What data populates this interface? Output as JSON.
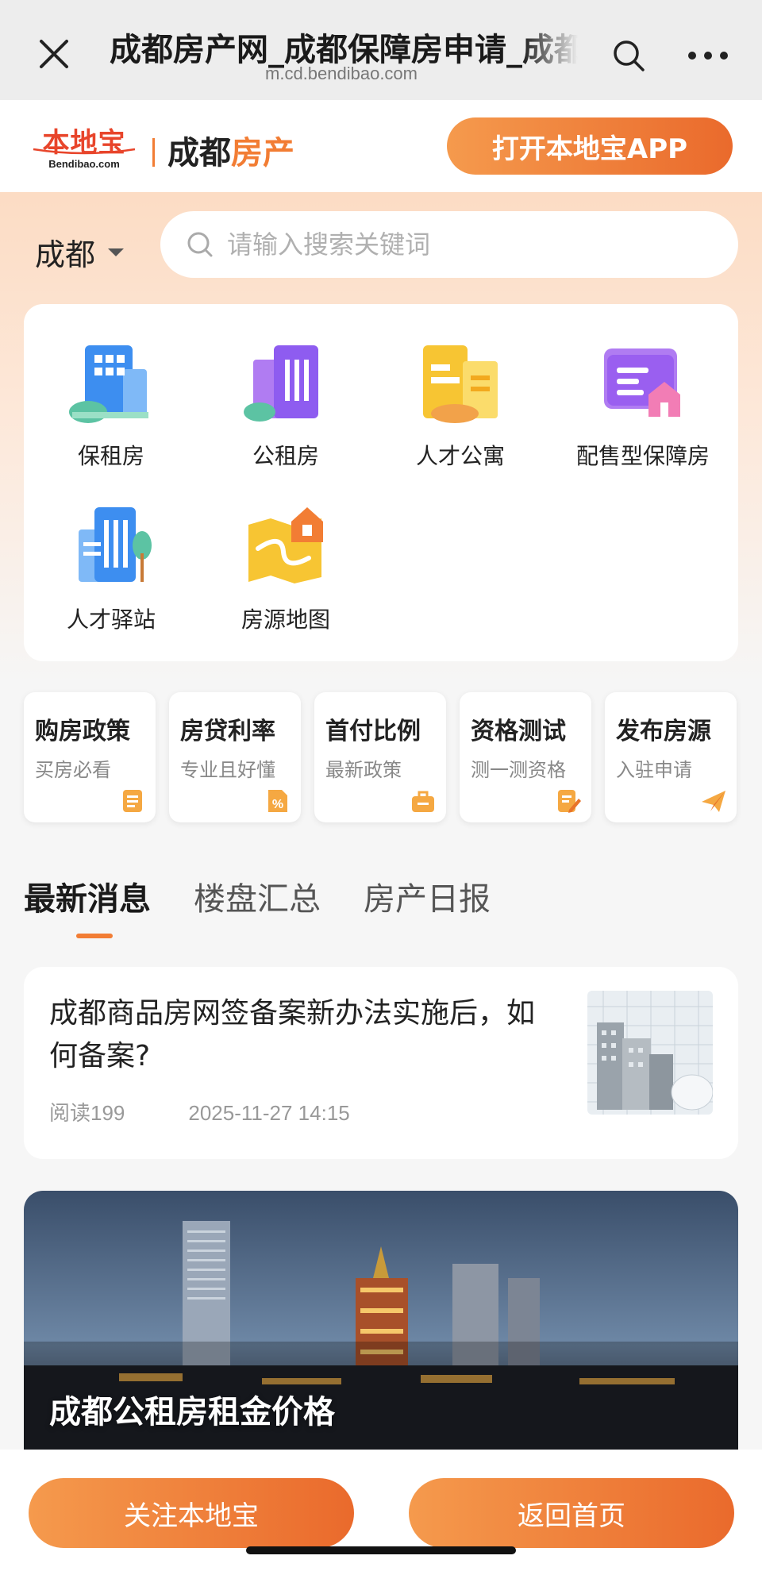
{
  "browser": {
    "title": "成都房产网_成都保障房申请_成都房产",
    "url": "m.cd.bendibao.com"
  },
  "header": {
    "logo_cn": "本地宝",
    "logo_en": "Bendibao.com",
    "site_name_a": "成都",
    "site_name_b": "房产",
    "open_app": "打开本地宝APP"
  },
  "search": {
    "city": "成都",
    "placeholder": "请输入搜索关键词"
  },
  "categories": [
    {
      "label": "保租房",
      "icon": "rental-building-icon"
    },
    {
      "label": "公租房",
      "icon": "public-rental-icon"
    },
    {
      "label": "人才公寓",
      "icon": "talent-apartment-icon"
    },
    {
      "label": "配售型保障房",
      "icon": "subsidized-housing-icon"
    },
    {
      "label": "人才驿站",
      "icon": "talent-station-icon"
    },
    {
      "label": "房源地图",
      "icon": "housing-map-icon"
    }
  ],
  "quick_links": [
    {
      "title": "购房政策",
      "subtitle": "买房必看",
      "icon": "document-icon"
    },
    {
      "title": "房贷利率",
      "subtitle": "专业且好懂",
      "icon": "percent-icon"
    },
    {
      "title": "首付比例",
      "subtitle": "最新政策",
      "icon": "briefcase-icon"
    },
    {
      "title": "资格测试",
      "subtitle": "测一测资格",
      "icon": "edit-icon"
    },
    {
      "title": "发布房源",
      "subtitle": "入驻申请",
      "icon": "paper-plane-icon"
    }
  ],
  "tabs": [
    "最新消息",
    "楼盘汇总",
    "房产日报"
  ],
  "articles": [
    {
      "title": "成都商品房网签备案新办法实施后，如何备案?",
      "reads": "阅读199",
      "time": "2025-11-27 14:15"
    }
  ],
  "feature": {
    "title": "成都公租房租金价格"
  },
  "bottom": {
    "follow": "关注本地宝",
    "home": "返回首页"
  },
  "colors": {
    "accent": "#f27d34",
    "accent_dark": "#ea6a2c"
  }
}
